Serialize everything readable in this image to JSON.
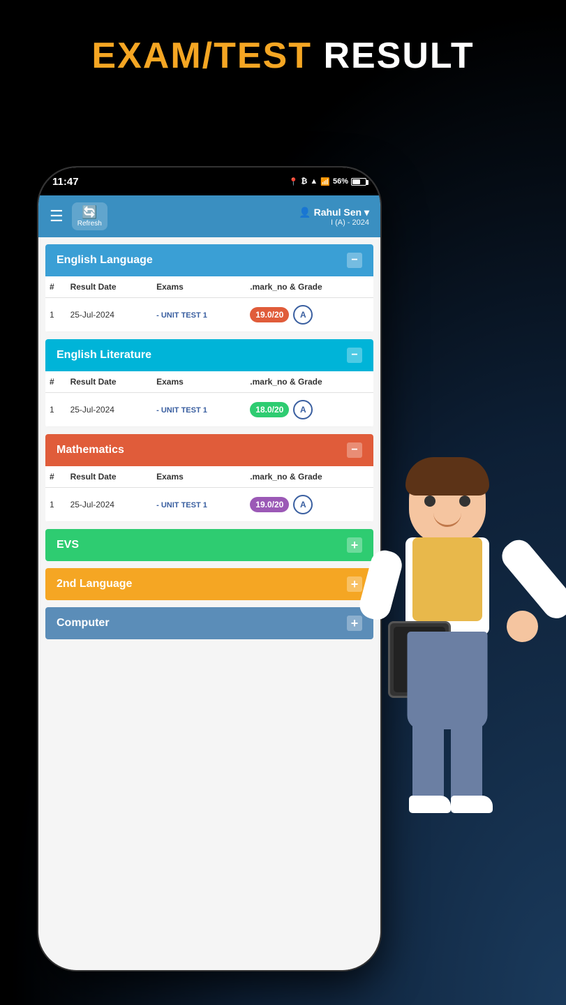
{
  "page": {
    "title_orange": "EXAM/TEST",
    "title_white": "RESULT"
  },
  "header": {
    "user_name": "Rahul Sen",
    "user_class": "I (A) - 2024",
    "refresh_label": "Refresh",
    "time": "11:47",
    "battery": "56%"
  },
  "subjects": [
    {
      "id": "english-language",
      "name": "English Language",
      "color": "blue",
      "expanded": true,
      "collapse_icon": "−",
      "columns": [
        "#",
        "Result Date",
        "Exams",
        ".mark_no & Grade"
      ],
      "rows": [
        {
          "num": 1,
          "date": "25-Jul-2024",
          "exam": "- UNIT TEST 1",
          "mark": "19.0/20",
          "mark_color": "red-pill",
          "grade": "A"
        }
      ]
    },
    {
      "id": "english-literature",
      "name": "English Literature",
      "color": "cyan",
      "expanded": true,
      "collapse_icon": "−",
      "columns": [
        "#",
        "Result Date",
        "Exams",
        ".mark_no & Grade"
      ],
      "rows": [
        {
          "num": 1,
          "date": "25-Jul-2024",
          "exam": "- UNIT TEST 1",
          "mark": "18.0/20",
          "mark_color": "green-pill",
          "grade": "A"
        }
      ]
    },
    {
      "id": "mathematics",
      "name": "Mathematics",
      "color": "red",
      "expanded": true,
      "collapse_icon": "−",
      "columns": [
        "#",
        "Result Date",
        "Exams",
        ".mark_no & Grade"
      ],
      "rows": [
        {
          "num": 1,
          "date": "25-Jul-2024",
          "exam": "- UNIT TEST 1",
          "mark": "19.0/20",
          "mark_color": "purple-pill",
          "grade": "A"
        }
      ]
    },
    {
      "id": "evs",
      "name": "EVS",
      "color": "green",
      "expanded": false,
      "collapse_icon": "+"
    },
    {
      "id": "2nd-language",
      "name": "2nd Language",
      "color": "orange",
      "expanded": false,
      "collapse_icon": "+"
    },
    {
      "id": "computer",
      "name": "Computer",
      "color": "steel",
      "expanded": false,
      "collapse_icon": "+"
    }
  ]
}
